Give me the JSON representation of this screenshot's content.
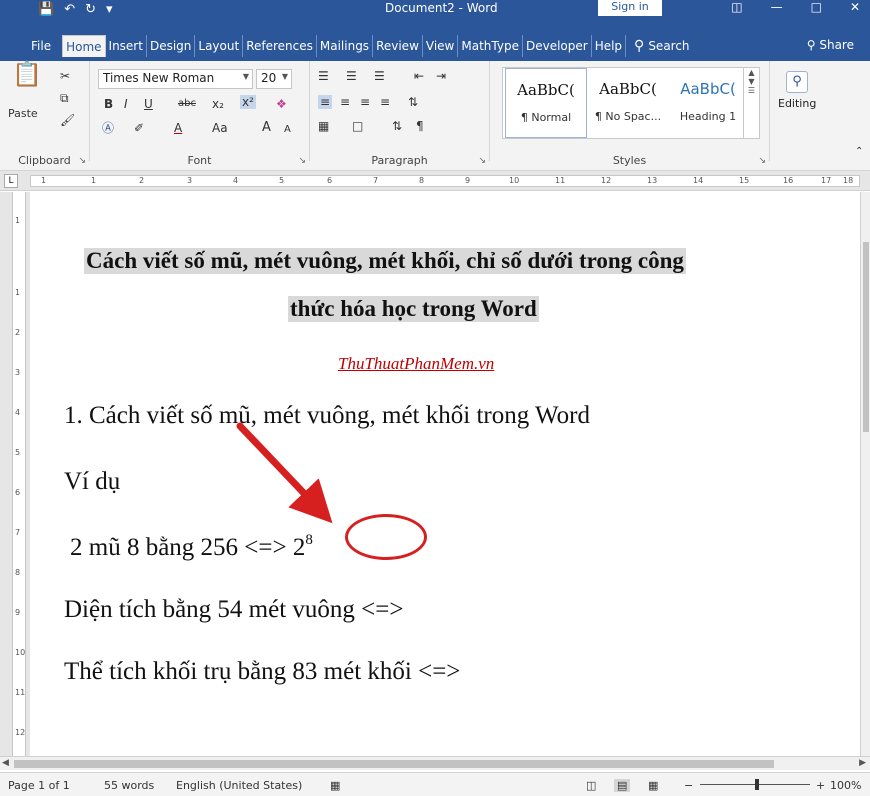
{
  "titlebar": {
    "save_icon": "save-icon",
    "undo_icon": "undo-icon",
    "redo_icon": "redo-icon",
    "title": "Document2 - Word",
    "signin": "Sign in"
  },
  "tabs": [
    "File",
    "Home",
    "Insert",
    "Design",
    "Layout",
    "References",
    "Mailings",
    "Review",
    "View",
    "MathType",
    "Developer",
    "Help"
  ],
  "search_label": "Search",
  "share_label": "Share",
  "ribbon": {
    "clipboard": {
      "paste": "Paste",
      "label": "Clipboard"
    },
    "font": {
      "name": "Times New Roman",
      "size": "20",
      "label": "Font",
      "bold": "B",
      "italic": "I",
      "underline": "U",
      "strike": "abc",
      "subscript": "x₂",
      "superscript": "x²",
      "changecase": "Aa",
      "grow": "A",
      "shrink": "A"
    },
    "paragraph": {
      "label": "Paragraph",
      "pilcrow": "¶"
    },
    "styles": {
      "label": "Styles",
      "items": [
        {
          "preview": "AaBbC(",
          "name": "¶ Normal"
        },
        {
          "preview": "AaBbC(",
          "name": "¶ No Spac..."
        },
        {
          "preview": "AaBbC(",
          "name": "Heading 1"
        }
      ]
    },
    "editing": {
      "label": "Editing"
    }
  },
  "ruler": {
    "numbers": [
      "1",
      "1",
      "2",
      "3",
      "4",
      "5",
      "6",
      "7",
      "8",
      "9",
      "10",
      "11",
      "12",
      "13",
      "14",
      "15",
      "16",
      "17",
      "18"
    ]
  },
  "vruler": {
    "numbers": [
      "1",
      "1",
      "2",
      "3",
      "4",
      "5",
      "6",
      "7",
      "8",
      "9",
      "10",
      "11",
      "12"
    ]
  },
  "document": {
    "title_line1": "Cách viết số mũ, mét vuông, mét khối, chỉ số dưới trong công",
    "title_line2": "thức hóa học trong Word",
    "site": "ThuThuatPhanMem.vn",
    "heading1": "1. Cách viết số mũ, mét vuông, mét khối trong Word",
    "example": "Ví dụ",
    "line_exp_text": "2 mũ 8 bằng 256 <=> 2",
    "line_exp_sup": "8",
    "line_area": "Diện tích bằng 54 mét vuông <=>",
    "line_volume": "Thể tích khối trụ bằng 83 mét khối <=>"
  },
  "status": {
    "page": "Page 1 of 1",
    "words": "55 words",
    "language": "English (United States)",
    "zoom": "100%",
    "zoom_minus": "−",
    "zoom_plus": "+"
  },
  "colors": {
    "ribbon_blue": "#2b579a",
    "highlight": "#d9d9d9",
    "link_red": "#c00000",
    "annotation_red": "#d62020"
  }
}
